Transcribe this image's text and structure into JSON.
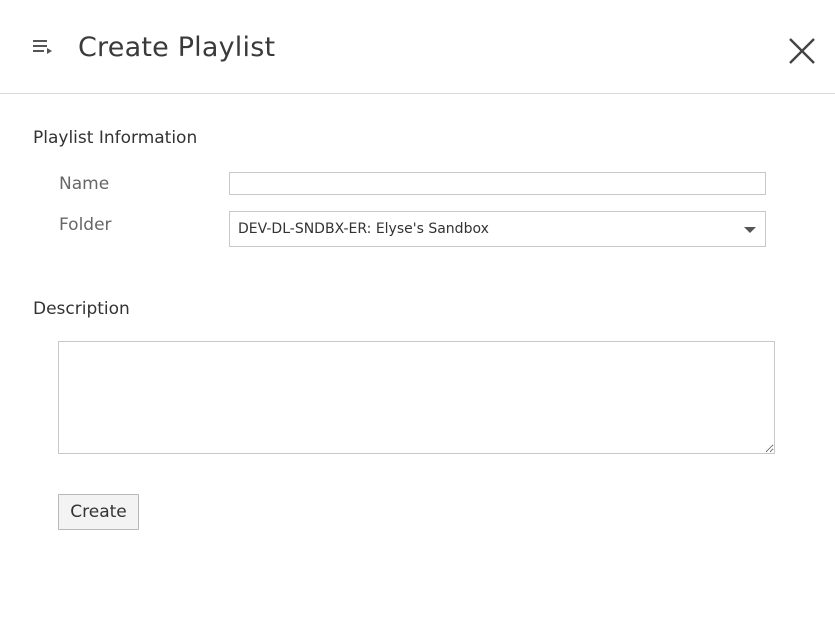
{
  "header": {
    "title": "Create Playlist",
    "menu_icon": "playlist-menu-icon",
    "close_icon": "close-icon"
  },
  "playlist_info": {
    "section_title": "Playlist Information",
    "name_label": "Name",
    "name_value": "",
    "folder_label": "Folder",
    "folder_value": "DEV-DL-SNDBX-ER: Elyse's Sandbox"
  },
  "description": {
    "section_title": "Description",
    "value": ""
  },
  "actions": {
    "create_label": "Create"
  }
}
